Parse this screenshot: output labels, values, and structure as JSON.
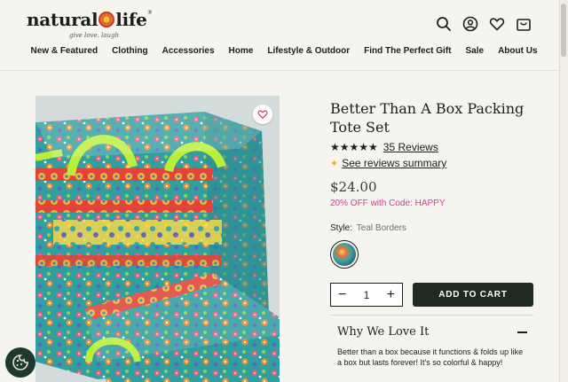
{
  "brand": {
    "name_left": "natural",
    "name_right": "life",
    "tagline": "give love. laugh"
  },
  "header_icons": [
    "search-icon",
    "account-icon",
    "wishlist-heart-icon",
    "cart-icon"
  ],
  "nav": {
    "items": [
      {
        "label": "New & Featured"
      },
      {
        "label": "Clothing"
      },
      {
        "label": "Accessories"
      },
      {
        "label": "Home"
      },
      {
        "label": "Lifestyle & Outdoor"
      },
      {
        "label": "Find The Perfect Gift"
      },
      {
        "label": "Sale"
      },
      {
        "label": "About Us"
      }
    ]
  },
  "product": {
    "title": "Better Than A Box Packing Tote Set",
    "rating_stars": "★★★★★",
    "reviews_label": "35 Reviews",
    "summary_label": "See reviews summary",
    "price": "$24.00",
    "promo": "20% OFF with Code: HAPPY",
    "style_label": "Style:",
    "style_value": "Teal Borders",
    "quantity": "1",
    "qty_minus": "−",
    "qty_plus": "+",
    "add_to_cart": "ADD TO CART",
    "accordion_title": "Why We Love It",
    "accordion_body": "Better than a box because it functions & folds up like a box but lasts forever! It's so colorful & happy!"
  },
  "colors": {
    "accent_dark": "#1e2a22",
    "promo_pink": "#d63a98",
    "background": "#f6f4ee"
  }
}
